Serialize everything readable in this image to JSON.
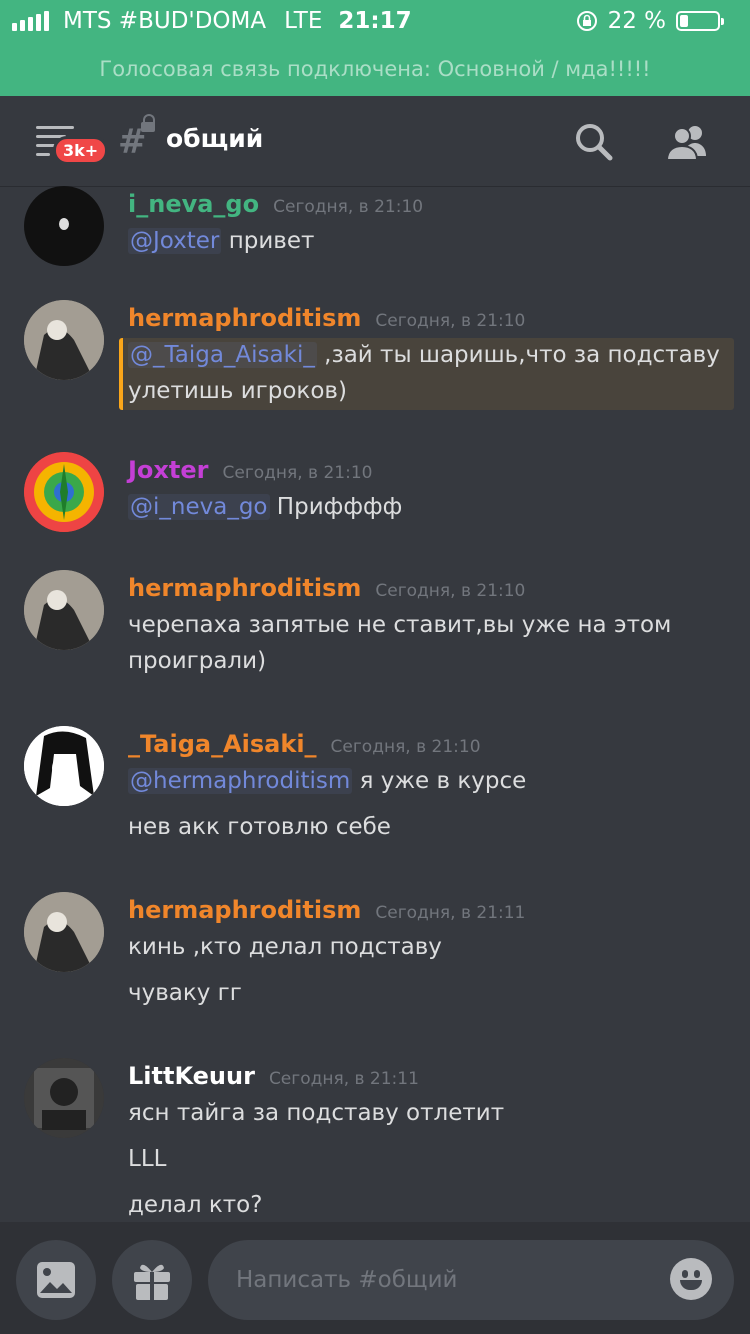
{
  "status_bar": {
    "carrier": "MTS #BUD'DOMA",
    "network": "LTE",
    "time": "21:17",
    "battery": "22 %",
    "battery_level": 0.22
  },
  "voice_banner": "Голосовая связь подключена: Основной / мда!!!!!",
  "header": {
    "badge": "3k+",
    "channel_name": "общий"
  },
  "colors": {
    "green": "#43b581",
    "orange_user": "#f0862b",
    "pink_user": "#c43fd6",
    "white_user": "#ffffff",
    "mention": "#7289da",
    "highlight_border": "#faa61a"
  },
  "messages": [
    {
      "author": "i_neva_go",
      "timestamp": "Сегодня, в 21:10",
      "lines": [
        {
          "mention": "@Joxter",
          "text": " привет"
        }
      ]
    },
    {
      "author": "hermaphroditism",
      "timestamp": "Сегодня, в 21:10",
      "lines": [
        {
          "mention": "@_Taiga_Aisaki_",
          "text": " ,зай ты шаришь,что за подставу"
        },
        {
          "text": "улетишь игроков)"
        }
      ]
    },
    {
      "author": "Joxter",
      "timestamp": "Сегодня, в 21:10",
      "lines": [
        {
          "mention": "@i_neva_go",
          "text": " Прифффф"
        }
      ]
    },
    {
      "author": "hermaphroditism",
      "timestamp": "Сегодня, в 21:10",
      "lines": [
        {
          "text": "черепаха запятые не ставит,вы уже на этом"
        },
        {
          "text": "проиграли)"
        }
      ]
    },
    {
      "author": "_Taiga_Aisaki_",
      "timestamp": "Сегодня, в 21:10",
      "lines": [
        {
          "mention": "@hermaphroditism",
          "text": " я уже в курсе"
        },
        {
          "text": "нев акк готовлю себе"
        }
      ]
    },
    {
      "author": "hermaphroditism",
      "timestamp": "Сегодня, в 21:11",
      "lines": [
        {
          "text": "кинь ,кто делал подставу"
        },
        {
          "text": "чуваку гг"
        }
      ]
    },
    {
      "author": "LittKeuur",
      "timestamp": "Сегодня, в 21:11",
      "lines": [
        {
          "text": "ясн тайга за подставу отлетит"
        },
        {
          "text": "LLL"
        },
        {
          "text": "делал кто?"
        }
      ]
    }
  ],
  "input": {
    "placeholder": "Написать #общий"
  }
}
